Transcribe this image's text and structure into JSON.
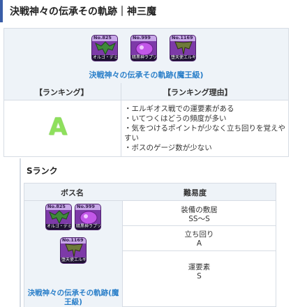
{
  "page_title": "決戦神々の伝承その軌跡｜神三魔",
  "ranking_table": {
    "bosses": [
      {
        "no": "No.825",
        "caption": "オルゴ・デミーラ"
      },
      {
        "no": "No.999",
        "caption": "暗黒神ラプソーン"
      },
      {
        "no": "No.1169",
        "caption": "堕天使エルギオス"
      }
    ],
    "boss_title": "決戦神々の伝承その軌跡(魔王級)",
    "col_ranking": "【ランキング】",
    "col_reason": "【ランキング理由】",
    "rank": "A",
    "reasons": [
      "・エルギオス戦での運要素がある",
      "・いてつくはどうの頻度が多い",
      "・気をつけるポイントが少なく立ち回りを覚えやすい",
      "・ボスのゲージ数が少ない"
    ]
  },
  "s_rank_section": {
    "title": "Sランク",
    "col_boss": "ボス名",
    "col_difficulty": "難易度",
    "boss_title": "決戦神々の伝承その軌跡(魔王級)",
    "difficulty": [
      {
        "label": "装備の敷居",
        "value": "SS〜S"
      },
      {
        "label": "立ち回り",
        "value": "A"
      },
      {
        "label": "運要素",
        "value": "S"
      }
    ]
  },
  "colors": {
    "accent": "#3a5ea8",
    "link": "#2a7fc9",
    "rank_a": "#8ee05c",
    "header_bg": "#eef3f8"
  },
  "icons": [
    "winged-demon-icon",
    "purple-orb-icon",
    "fallen-angel-icon"
  ]
}
